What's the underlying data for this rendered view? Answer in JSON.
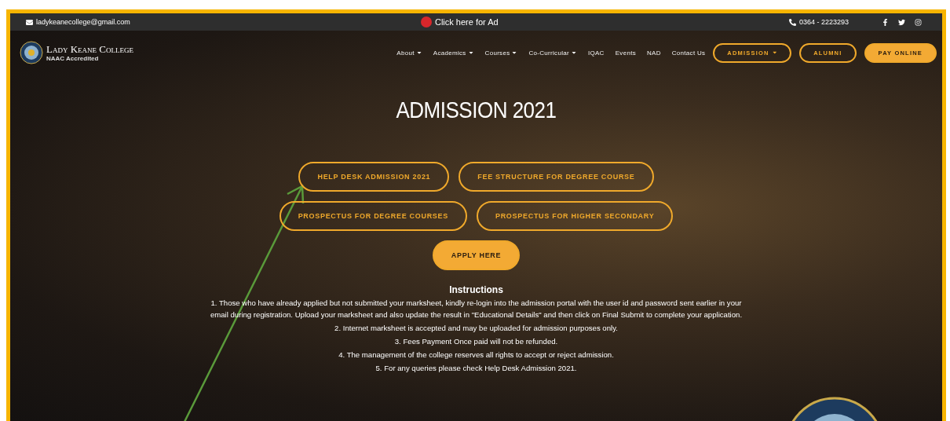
{
  "top_bar": {
    "email": "ladykeanecollege@gmail.com",
    "ad_link": "Click here for Ad",
    "phone": "0364 - 2223293"
  },
  "logo": {
    "name": "Lady Keane College",
    "accreditation": "NAAC Accredited"
  },
  "nav": {
    "links": [
      {
        "label": "About",
        "dropdown": true
      },
      {
        "label": "Academics",
        "dropdown": true
      },
      {
        "label": "Courses",
        "dropdown": true
      },
      {
        "label": "Co-Curricular",
        "dropdown": true
      },
      {
        "label": "IQAC",
        "dropdown": false
      },
      {
        "label": "Events",
        "dropdown": false
      },
      {
        "label": "NAD",
        "dropdown": false
      },
      {
        "label": "Contact Us",
        "dropdown": false
      }
    ],
    "buttons": [
      {
        "label": "ADMISSION",
        "kind": "outline",
        "dropdown": true
      },
      {
        "label": "ALUMNI",
        "kind": "outline",
        "dropdown": false
      },
      {
        "label": "PAY ONLINE",
        "kind": "filled",
        "dropdown": false
      }
    ]
  },
  "hero": {
    "title": "ADMISSION 2021",
    "button_rows": [
      [
        {
          "label": "HELP DESK ADMISSION 2021",
          "kind": "outline"
        },
        {
          "label": "FEE STRUCTURE FOR DEGREE COURSE",
          "kind": "outline"
        }
      ],
      [
        {
          "label": "PROSPECTUS FOR DEGREE COURSES",
          "kind": "outline"
        },
        {
          "label": "PROSPECTUS FOR HIGHER SECONDARY",
          "kind": "outline"
        }
      ],
      [
        {
          "label": "APPLY HERE",
          "kind": "filled"
        }
      ]
    ],
    "instructions_title": "Instructions",
    "instructions": [
      "1. Those who have already applied but not submitted your marksheet, kindly re-login into the admission portal with the user id and password sent earlier in your email during registration. Upload your marksheet and also update the result in \"Educational Details\" and then click on Final Submit to complete your application.",
      "2. Internet marksheet is accepted and may be uploaded for admission purposes only.",
      "3. Fees Payment Once paid will not be refunded.",
      "4. The management of the college reserves all rights to accept or reject admission.",
      "5. For any queries please check Help Desk Admission 2021."
    ]
  }
}
